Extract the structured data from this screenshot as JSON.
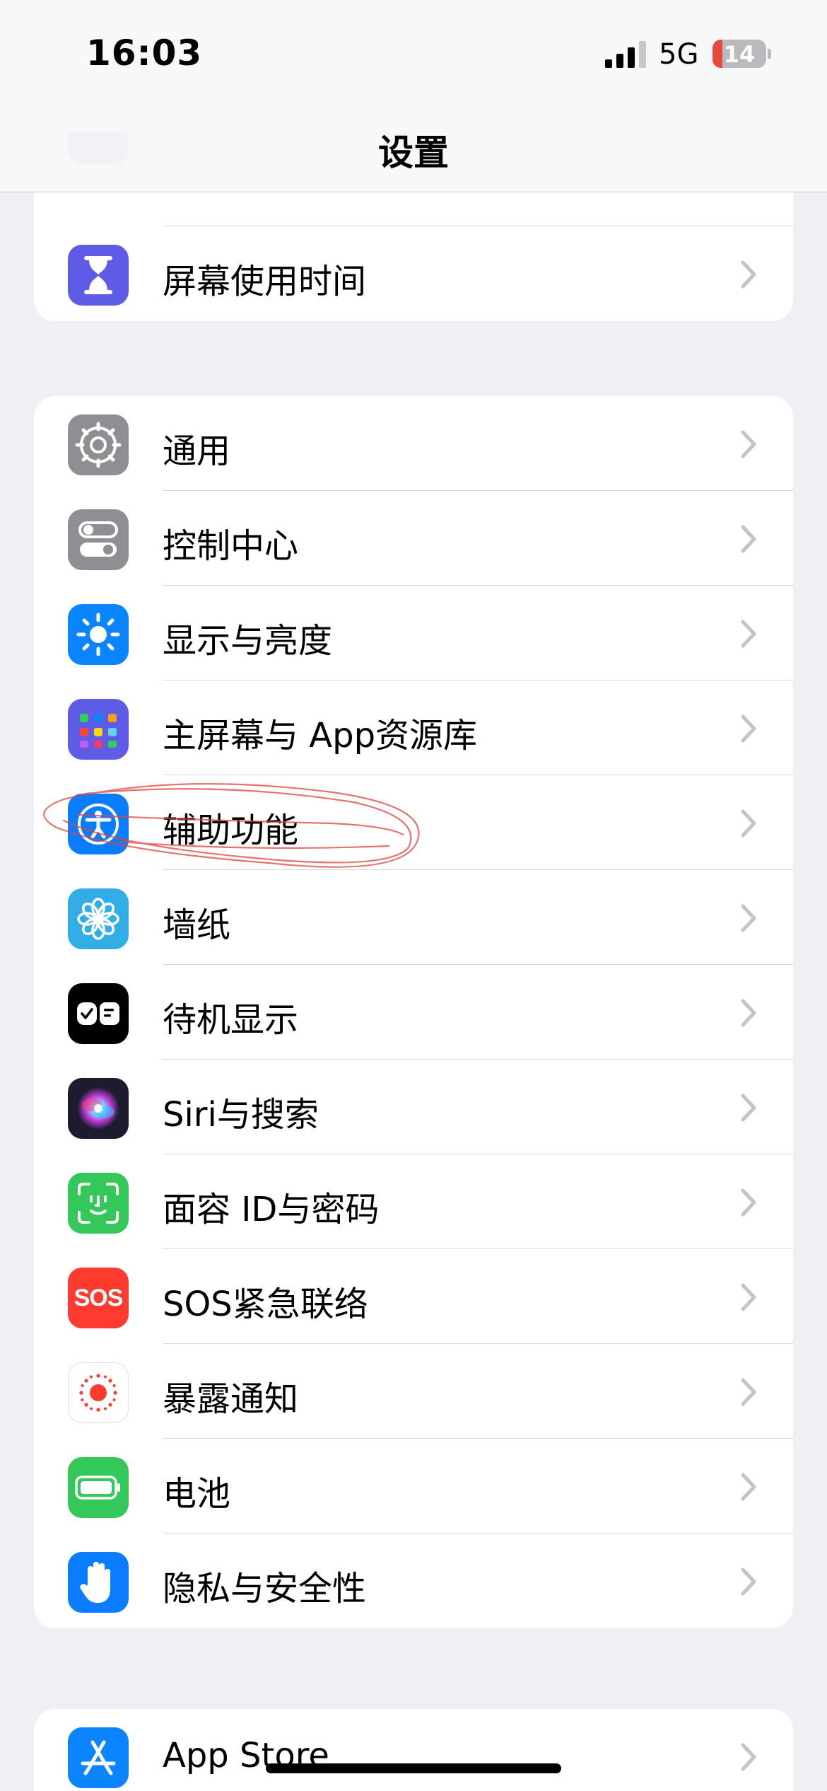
{
  "status": {
    "time": "16:03",
    "network": "5G",
    "battery": "14",
    "battery_level": 0.14
  },
  "nav": {
    "title": "设置"
  },
  "group1": {
    "items": [
      {
        "label": "屏幕使用时间",
        "icon": "hourglass-icon",
        "color": "#5e5ce6"
      }
    ]
  },
  "group2": {
    "items": [
      {
        "label": "通用",
        "icon": "gear-icon",
        "color": "#8e8e93"
      },
      {
        "label": "控制中心",
        "icon": "toggles-icon",
        "color": "#8e8e93"
      },
      {
        "label": "显示与亮度",
        "icon": "sun-icon",
        "color": "#0a84ff"
      },
      {
        "label": "主屏幕与 App资源库",
        "icon": "home-grid-icon",
        "color": "#5e5ce6"
      },
      {
        "label": "辅助功能",
        "icon": "accessibility-icon",
        "color": "#0a7cff"
      },
      {
        "label": "墙纸",
        "icon": "flower-icon",
        "color": "#32ade6"
      },
      {
        "label": "待机显示",
        "icon": "standby-icon",
        "color": "#000000"
      },
      {
        "label": "Siri与搜索",
        "icon": "siri-icon",
        "color": "#1c1c2e"
      },
      {
        "label": "面容 ID与密码",
        "icon": "face-id-icon",
        "color": "#34c759"
      },
      {
        "label": "SOS紧急联络",
        "icon": "sos-icon",
        "color": "#ff3b30"
      },
      {
        "label": "暴露通知",
        "icon": "exposure-icon",
        "color": "#ffffff"
      },
      {
        "label": "电池",
        "icon": "battery-icon",
        "color": "#34c759"
      },
      {
        "label": "隐私与安全性",
        "icon": "hand-icon",
        "color": "#0a7cff"
      }
    ]
  },
  "group3": {
    "items": [
      {
        "label": "App Store",
        "icon": "app-store-icon",
        "color": "#0a84ff"
      }
    ]
  },
  "sos_text": "SOS"
}
